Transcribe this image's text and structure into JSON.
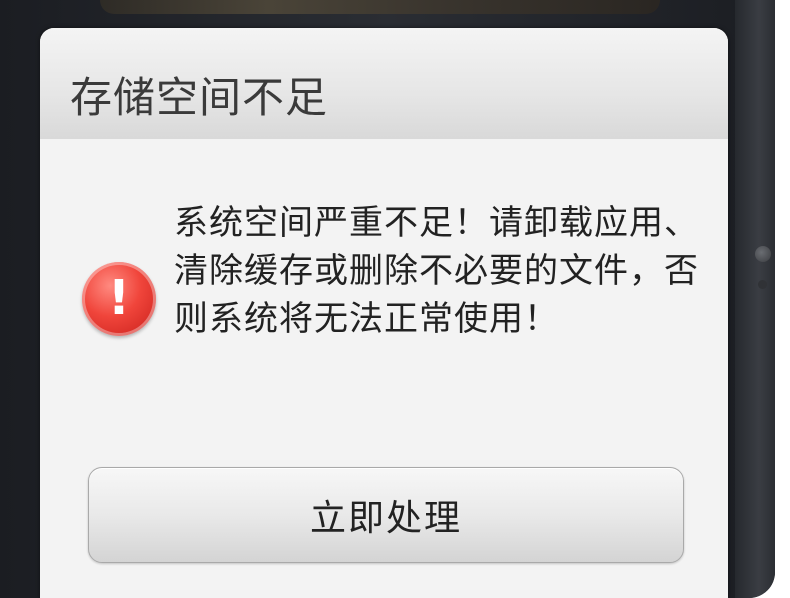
{
  "dialog": {
    "title": "存储空间不足",
    "icon": "warning-exclamation-icon",
    "message": "系统空间严重不足！请卸载应用、清除缓存或删除不必要的文件，否则系统将无法正常使用！",
    "button_label": "立即处理"
  },
  "colors": {
    "icon_red": "#e53935",
    "dialog_background": "#f3f3f3",
    "title_text": "#3a3a3a",
    "body_text": "#222222"
  }
}
